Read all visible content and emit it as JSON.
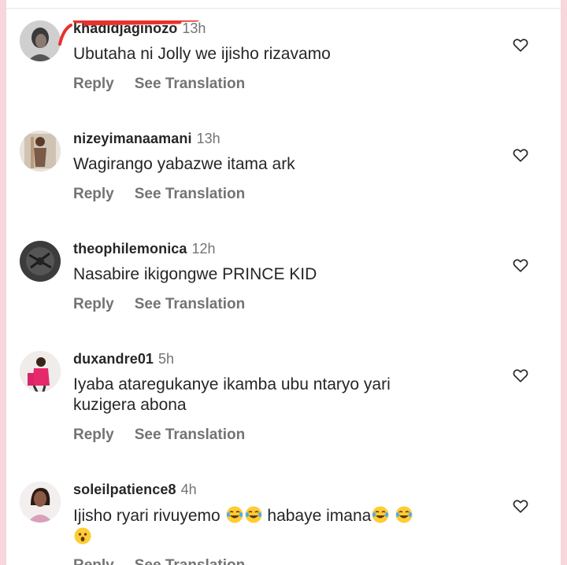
{
  "comments": [
    {
      "username": "khadidjaginozo",
      "time": "13h",
      "text": "Ubutaha ni Jolly we ijisho rizavamo",
      "reply_label": "Reply",
      "translate_label": "See Translation"
    },
    {
      "username": "nizeyimanaamani",
      "time": "13h",
      "text": "Wagirango yabazwe itama ark",
      "reply_label": "Reply",
      "translate_label": "See Translation"
    },
    {
      "username": "theophilemonica",
      "time": "12h",
      "text": "Nasabire ikigongwe PRINCE KID",
      "reply_label": "Reply",
      "translate_label": "See Translation"
    },
    {
      "username": "duxandre01",
      "time": "5h",
      "text": "Iyaba ataregukanye ikamba ubu ntaryo yari kuzigera abona",
      "reply_label": "Reply",
      "translate_label": "See Translation"
    },
    {
      "username": "soleilpatience8",
      "time": "4h",
      "text_part1": "Ijisho ryari rivuyemo ",
      "text_part2": " habaye imana",
      "reply_label": "Reply",
      "translate_label": "See Translation"
    }
  ],
  "icons": {
    "like": "heart-outline-icon",
    "laughing": "face-with-tears-of-joy-emoji",
    "surprised": "astonished-face-emoji"
  },
  "colors": {
    "background_border": "#f7d6dc",
    "username": "#262626",
    "secondary_text": "#737373",
    "redaction": "#e8322c"
  }
}
